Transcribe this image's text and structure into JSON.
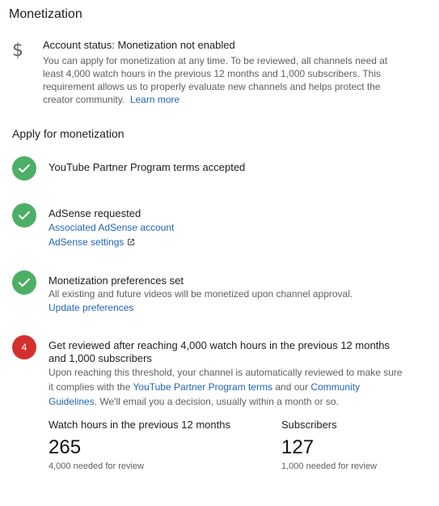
{
  "page": {
    "title": "Monetization"
  },
  "account_status": {
    "icon": "dollar-icon",
    "heading": "Account status: Monetization not enabled",
    "description": "You can apply for monetization at any time. To be reviewed, all channels need at least 4,000 watch hours in the previous 12 months and 1,000 subscribers. This requirement allows us to properly evaluate new channels and helps protect the creator community.",
    "learn_more_label": "Learn more"
  },
  "apply": {
    "section_title": "Apply for monetization",
    "steps": [
      {
        "status": "done",
        "title": "YouTube Partner Program terms accepted"
      },
      {
        "status": "done",
        "title": "AdSense requested",
        "links": [
          "Associated AdSense account",
          "AdSense settings"
        ]
      },
      {
        "status": "done",
        "title": "Monetization preferences set",
        "description": "All existing and future videos will be monetized upon channel approval.",
        "link": "Update preferences"
      },
      {
        "status": "todo",
        "number": "4",
        "title": "Get reviewed after reaching 4,000 watch hours in the previous 12 months and 1,000 subscribers",
        "description_before": "Upon reaching this threshold, your channel is automatically reviewed to make sure it complies with the ",
        "link_terms": "YouTube Partner Program terms",
        "description_middle": " and our ",
        "link_guidelines": "Community Guidelines",
        "description_after": ". We'll email you a decision, usually within a month or so."
      }
    ]
  },
  "stats": {
    "watch_hours": {
      "label": "Watch hours in the previous 12 months",
      "value": "265",
      "note": "4,000 needed for review"
    },
    "subscribers": {
      "label": "Subscribers",
      "value": "127",
      "note": "1,000 needed for review"
    }
  },
  "colors": {
    "done_badge": "#4caf65",
    "todo_badge": "#d32f2f",
    "link": "#2265b5"
  }
}
